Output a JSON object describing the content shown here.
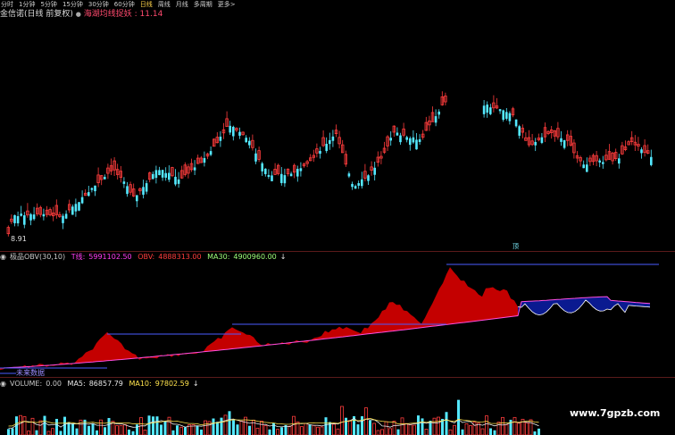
{
  "toolbar": {
    "items": [
      {
        "label": "分时"
      },
      {
        "label": "1分钟"
      },
      {
        "label": "5分钟"
      },
      {
        "label": "15分钟"
      },
      {
        "label": "30分钟"
      },
      {
        "label": "60分钟"
      },
      {
        "label": "日线",
        "active": true
      },
      {
        "label": "周线"
      },
      {
        "label": "月线"
      },
      {
        "label": "多周期"
      },
      {
        "label": "更多>"
      }
    ]
  },
  "main_chart": {
    "stock_title": "金信诺(日线 前复权)",
    "indicator_name": "海湖均线捉妖",
    "indicator_value": ": 11.14",
    "low_label": "8.91",
    "marker_label": "顶"
  },
  "obv_panel": {
    "name": "极品OBV(30,10)",
    "t_label": "T线:",
    "t_value": "5991102.50",
    "obv_label": "OBV:",
    "obv_value": "4888313.00",
    "ma30_label": "MA30:",
    "ma30_value": "4900960.00",
    "arrow": "↓",
    "bottom_label": "未来数据"
  },
  "volume_panel": {
    "volume_label": "VOLUME:",
    "volume_value": "0.00",
    "ma5_label": "MA5:",
    "ma5_value": "86857.79",
    "ma10_label": "MA10:",
    "ma10_value": "97802.59",
    "arrow": "↓"
  },
  "watermark": "www.7gpzb.com",
  "colors": {
    "up": "#ff3d3d",
    "down": "#54e8ff",
    "obv_fill": "#c40000",
    "obv_line": "#ff4fe0",
    "ma_fill": "#0a1a90",
    "ma_line": "#6d7cff",
    "t_line": "#4a5cff",
    "separator": "#5a1a1a"
  }
}
